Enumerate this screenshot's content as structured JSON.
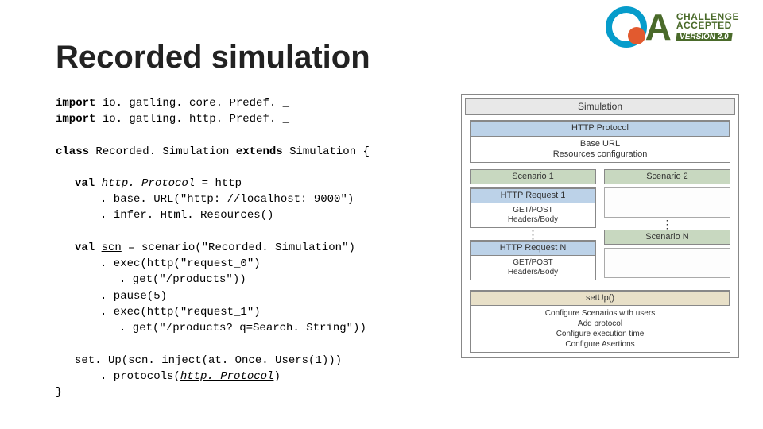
{
  "logo": {
    "line1": "CHALLENGE",
    "line2": "ACCEPTED",
    "line3": "VERSION 2.0",
    "a": "A"
  },
  "title": "Recorded simulation",
  "code": {
    "l1_kw": "import",
    "l1_rest": " io. gatling. core. Predef. _",
    "l2_kw": "import",
    "l2_rest": " io. gatling. http. Predef. _",
    "l3_kw": "class ",
    "l3_mid": "Recorded. Simulation ",
    "l3_kw2": "extends ",
    "l3_end": "Simulation {",
    "l4_kw": "val ",
    "l4_it": "http. Protocol",
    "l4_rest": " = http",
    "l5": ". base. URL(\"http: //localhost: 9000\")",
    "l6": ". infer. Html. Resources()",
    "l7_kw": "val ",
    "l7_ul": "scn",
    "l7_rest": " = scenario(\"Recorded. Simulation\")",
    "l8": ". exec(http(\"request_0\")",
    "l9": ". get(\"/products\"))",
    "l10": ". pause(5)",
    "l11": ". exec(http(\"request_1\")",
    "l12": ". get(\"/products? q=Search. String\"))",
    "l13": "set. Up(scn. inject(at. Once. Users(1)))",
    "l14_a": ". protocols(",
    "l14_it": "http. Protocol",
    "l14_b": ")",
    "l15": "}"
  },
  "diagram": {
    "sim": "Simulation",
    "proto_head": "HTTP Protocol",
    "proto_body": "Base URL\nResources configuration",
    "sc1": "Scenario 1",
    "sc2": "Scenario 2",
    "req1_head": "HTTP Request 1",
    "req1_body": "GET/POST\nHeaders/Body",
    "reqn_head": "HTTP Request N",
    "reqn_body": "GET/POST\nHeaders/Body",
    "scn": "Scenario N",
    "setup_head": "setUp()",
    "setup_body": "Configure Scenarios with users\nAdd protocol\nConfigure execution time\nConfigure Asertions"
  }
}
